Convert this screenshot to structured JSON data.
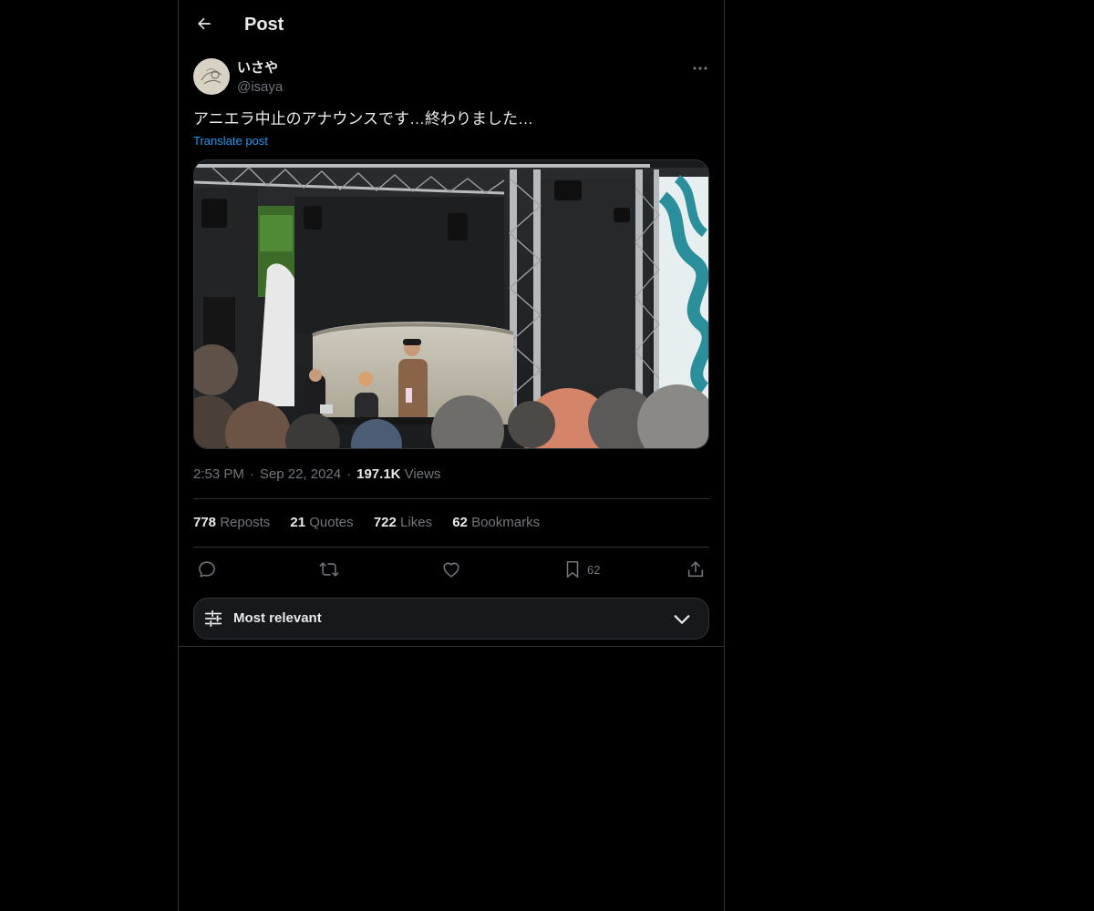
{
  "header": {
    "title": "Post"
  },
  "post": {
    "author_name": "いさや",
    "author_handle": "@isaya",
    "text": "アニエラ中止のアナウンスです…終わりました…",
    "translate_label": "Translate post",
    "time": "2:53 PM",
    "date": "Sep 22, 2024",
    "views_count": "197.1K",
    "views_label": "Views",
    "stats": {
      "reposts": {
        "count": "778",
        "label": "Reposts"
      },
      "quotes": {
        "count": "21",
        "label": "Quotes"
      },
      "likes": {
        "count": "722",
        "label": "Likes"
      },
      "bookmarks": {
        "count": "62",
        "label": "Bookmarks"
      }
    },
    "actions": {
      "bookmark_count": "62"
    }
  },
  "sort": {
    "label": "Most relevant"
  },
  "icons": {
    "back": "arrow-left-icon",
    "more": "more-horizontal-icon",
    "reply": "reply-icon",
    "repost": "repost-icon",
    "like": "heart-icon",
    "bookmark": "bookmark-icon",
    "share": "share-icon",
    "sort": "sliders-icon",
    "chevron": "chevron-down-icon"
  },
  "colors": {
    "background": "#000000",
    "text": "#e7e9ea",
    "muted": "#71767b",
    "link": "#1d9bf0",
    "border": "#2f3336"
  }
}
